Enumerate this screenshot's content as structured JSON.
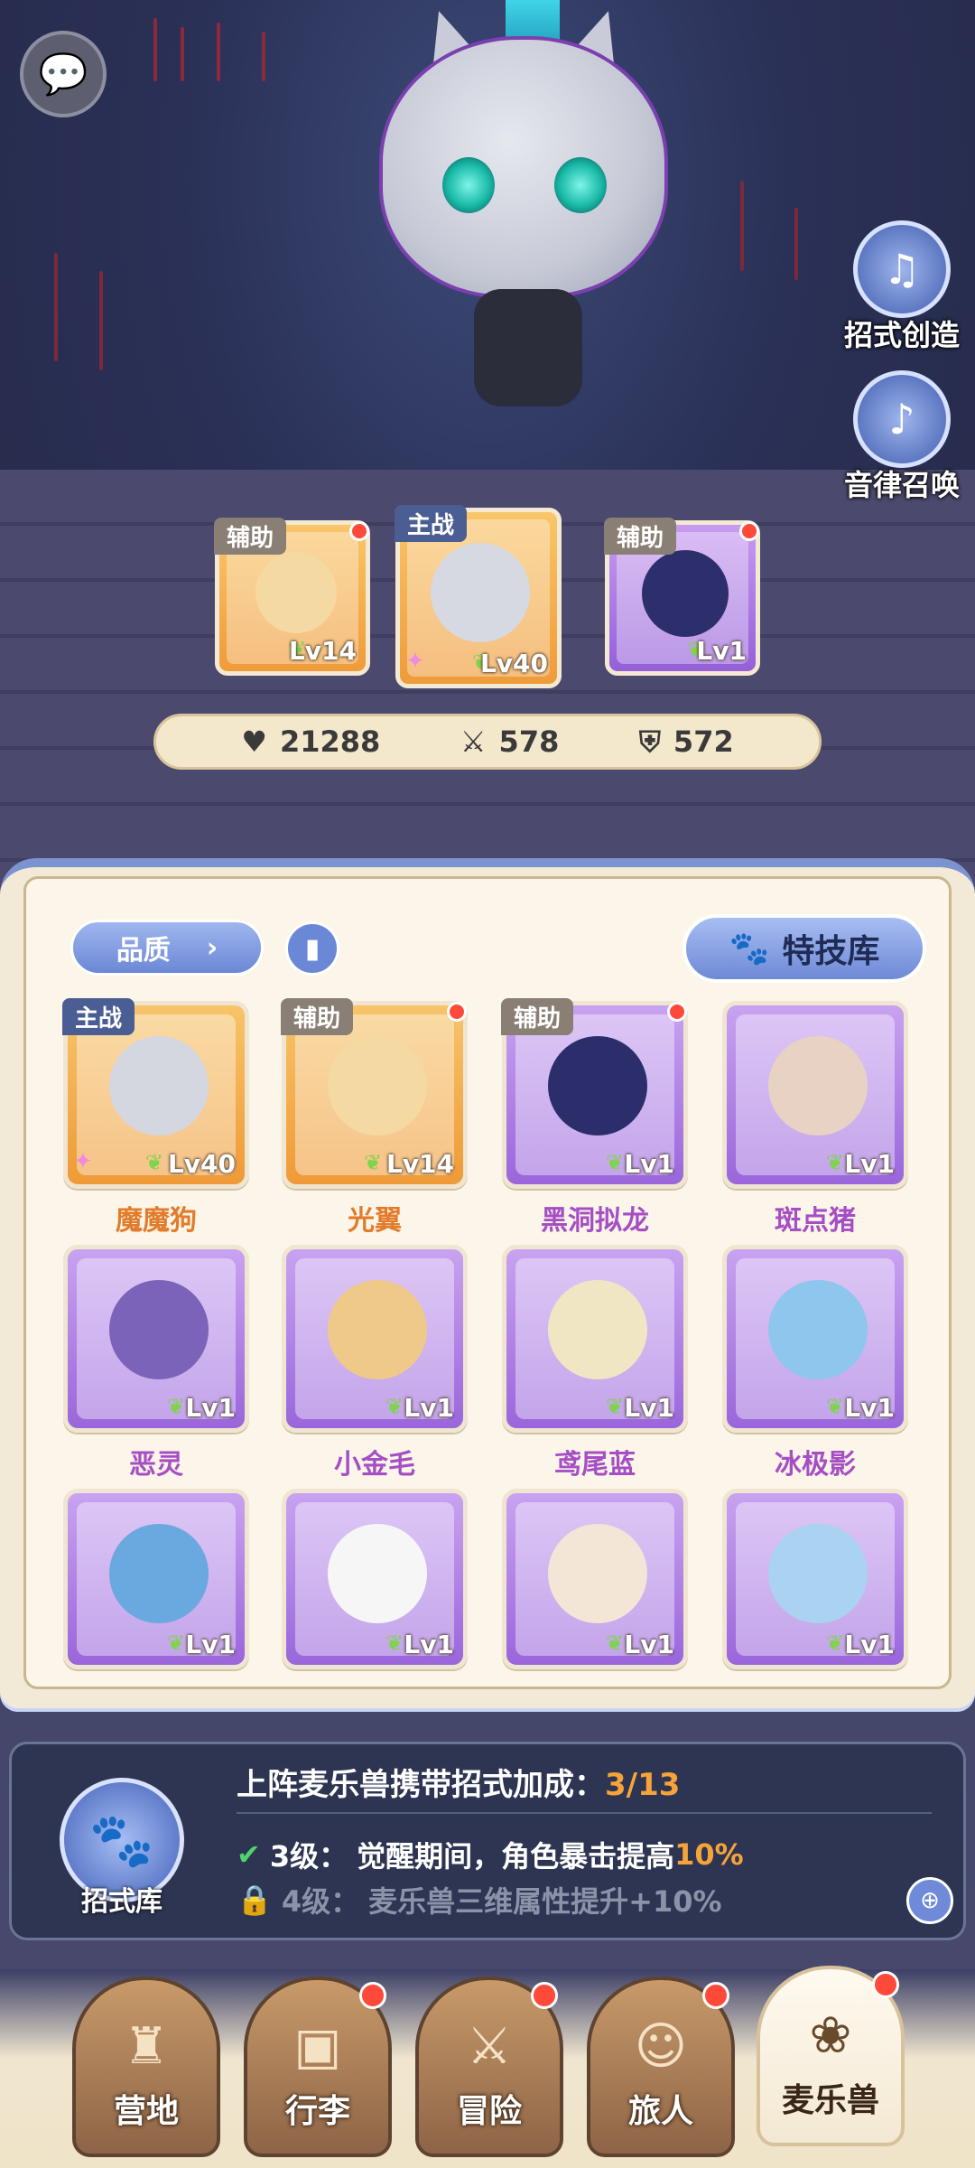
{
  "side_buttons": [
    {
      "label": "招式创造",
      "icon": "book-music-icon"
    },
    {
      "label": "音律召唤",
      "icon": "lyre-icon"
    }
  ],
  "team": [
    {
      "role": "辅助",
      "level": "Lv14",
      "color": "gold",
      "alert": true
    },
    {
      "role": "主战",
      "level": "Lv40",
      "color": "gold",
      "alert": false
    },
    {
      "role": "辅助",
      "level": "Lv1",
      "color": "purple",
      "alert": true
    }
  ],
  "stats": {
    "hp": "21288",
    "attack": "578",
    "defense": "572"
  },
  "filter": {
    "quality_label": "品质",
    "skills_label": "特技库"
  },
  "roster": [
    {
      "name": "魔魔狗",
      "level": "Lv40",
      "role": "主战",
      "rarity": "gold",
      "alert": false
    },
    {
      "name": "光翼",
      "level": "Lv14",
      "role": "辅助",
      "rarity": "gold",
      "alert": true
    },
    {
      "name": "黑洞拟龙",
      "level": "Lv1",
      "role": "辅助",
      "rarity": "purple",
      "alert": true
    },
    {
      "name": "斑点猪",
      "level": "Lv1",
      "role": "",
      "rarity": "purple",
      "alert": false
    },
    {
      "name": "恶灵",
      "level": "Lv1",
      "role": "",
      "rarity": "purple",
      "alert": false
    },
    {
      "name": "小金毛",
      "level": "Lv1",
      "role": "",
      "rarity": "purple",
      "alert": false
    },
    {
      "name": "鸢尾蓝",
      "level": "Lv1",
      "role": "",
      "rarity": "purple",
      "alert": false
    },
    {
      "name": "冰极影",
      "level": "Lv1",
      "role": "",
      "rarity": "purple",
      "alert": false
    },
    {
      "name": "",
      "level": "Lv1",
      "role": "",
      "rarity": "purple",
      "alert": false
    },
    {
      "name": "",
      "level": "Lv1",
      "role": "",
      "rarity": "purple",
      "alert": false
    },
    {
      "name": "",
      "level": "Lv1",
      "role": "",
      "rarity": "purple",
      "alert": false
    },
    {
      "name": "",
      "level": "Lv1",
      "role": "",
      "rarity": "purple",
      "alert": false
    }
  ],
  "bonus": {
    "title": "上阵麦乐兽携带招式加成：",
    "progress": "3/13",
    "library_label": "招式库",
    "line1_level": "3级：",
    "line1_text_a": "觉醒期间，角色暴击提高",
    "line1_pct": "10%",
    "line2_level": "4级：",
    "line2_text": "麦乐兽三维属性提升+10%"
  },
  "nav": [
    {
      "label": "营地",
      "icon": "castle-icon",
      "alert": false,
      "active": false
    },
    {
      "label": "行李",
      "icon": "chest-icon",
      "alert": true,
      "active": false
    },
    {
      "label": "冒险",
      "icon": "swords-icon",
      "alert": true,
      "active": false
    },
    {
      "label": "旅人",
      "icon": "traveler-icon",
      "alert": true,
      "active": false
    },
    {
      "label": "麦乐兽",
      "icon": "pet-icon",
      "alert": true,
      "active": true
    }
  ],
  "colors": {
    "accent": "#6b88d6",
    "gold": "#ef9b3a",
    "purple": "#9a66db",
    "alert": "#ff4a3a",
    "highlight": "#f6a33a"
  }
}
